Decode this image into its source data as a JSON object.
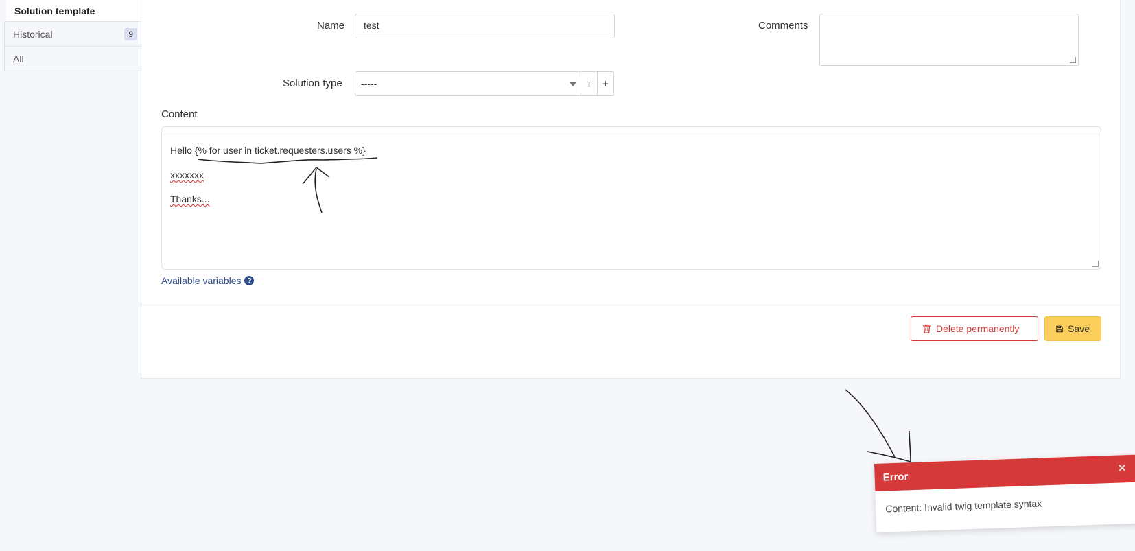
{
  "sidebar": {
    "items": [
      {
        "label": "Solution template"
      },
      {
        "label": "Historical",
        "badge": "9"
      },
      {
        "label": "All"
      }
    ]
  },
  "form": {
    "name_label": "Name",
    "name_value": "test",
    "comments_label": "Comments",
    "comments_value": "",
    "solution_type_label": "Solution type",
    "solution_type_value": "-----",
    "info_button": "i",
    "add_button": "+",
    "content_label": "Content",
    "content_lines": [
      "Hello {% for user in ticket.requesters.users %}",
      "xxxxxxx",
      "Thanks..."
    ],
    "available_variables": "Available variables",
    "help_icon_text": "?"
  },
  "actions": {
    "delete_label": "Delete permanently",
    "save_label": "Save"
  },
  "toast": {
    "title": "Error",
    "close": "×",
    "message": "Content: Invalid twig template syntax"
  },
  "colors": {
    "danger": "#d63939",
    "warning": "#fbcd5b",
    "link": "#2f4d8a"
  }
}
